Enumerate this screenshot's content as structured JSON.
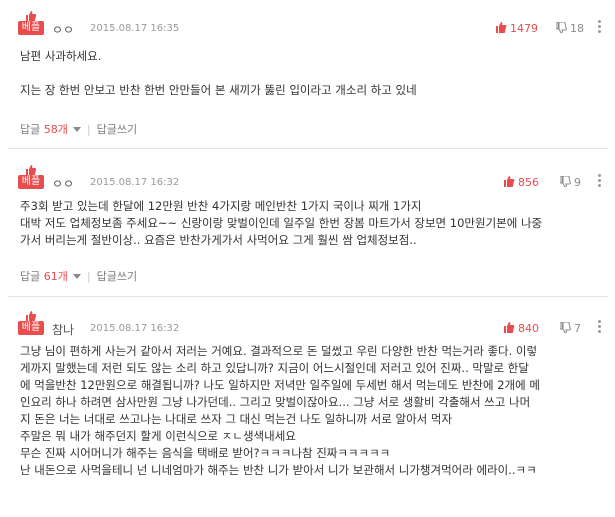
{
  "comments": [
    {
      "badge": "베플",
      "nickname": "ㅇㅇ",
      "date": "2015.08.17 16:35",
      "upvotes": "1479",
      "downvotes": "18",
      "text": "남편 사과하세요.\n\n지는 장 한번 안보고 반찬 한번 안만들어 본 새끼가 뚫린 입이라고 개소리 하고 있네",
      "reply_label": "답글",
      "reply_count": "58개",
      "write_reply": "답글쓰기"
    },
    {
      "badge": "베플",
      "nickname": "ㅇㅇ",
      "date": "2015.08.17 16:32",
      "upvotes": "856",
      "downvotes": "9",
      "text": "주3회 받고 있는데 한달에 12만원 반찬 4가지랑 메인반찬 1가지 국이나 찌개 1가지\n대박 저도 업체정보좀 주세요~~ 신랑이랑 맞벌이인데 일주일 한번 장봄 마트가서 장보면 10만원기본에 나중\n가서 버리는게 절반이상.. 요즘은 반찬가게가서 사먹어요 그게 훨씬 쌈 업체정보점..",
      "reply_label": "답글",
      "reply_count": "61개",
      "write_reply": "답글쓰기"
    },
    {
      "badge": "베플",
      "nickname": "참나",
      "date": "2015.08.17 16:32",
      "upvotes": "840",
      "downvotes": "7",
      "text": "그냥 님이 편하게 사는거 같아서 저러는 거예요. 결과적으로 돈 덜썼고 우린 다양한 반찬 먹는거라 좋다. 이렇\n게까지 말했는데 저런 되도 않는 소리 하고 있답니까? 지금이 어느시절인데 저러고 있어 진짜.. 막말로 한달\n에 먹을반찬 12만원으로 해결됩니까? 나도 일하지만 저녁만 일주일에 두세번 해서 먹는데도 반찬에 2개에 메\n인요리 하나 하려면 삼사만원 그냥 나가던데.. 그리고 맞벌이잖아요... 그냥 서로 생활비 각출해서 쓰고 나머\n지 돈은 너는 너대로 쓰고나는 나대로 쓰자 그 대신 먹는건 나도 일하니까 서로 알아서 먹자\n주말은 뭐 내가 해주던지 할게 이런식으로 ㅈㄴ생색내세요\n무슨 진짜 시어머니가 해주는 음식을 택배로 받어?ㅋㅋㅋ나참 진짜ㅋㅋㅋㅋㅋ\n난 내돈으로 사먹을테니 넌 니네엄마가 해주는 반찬 니가 받아서 니가 보관해서 니가챙겨먹어라 에라이..ㅋㅋ"
    }
  ],
  "colors": {
    "accent": "#e84c4c",
    "muted": "#9a9a9a"
  },
  "icons": [
    "thumb-up-icon",
    "thumb-down-icon",
    "more-icon",
    "caret-down-icon"
  ]
}
